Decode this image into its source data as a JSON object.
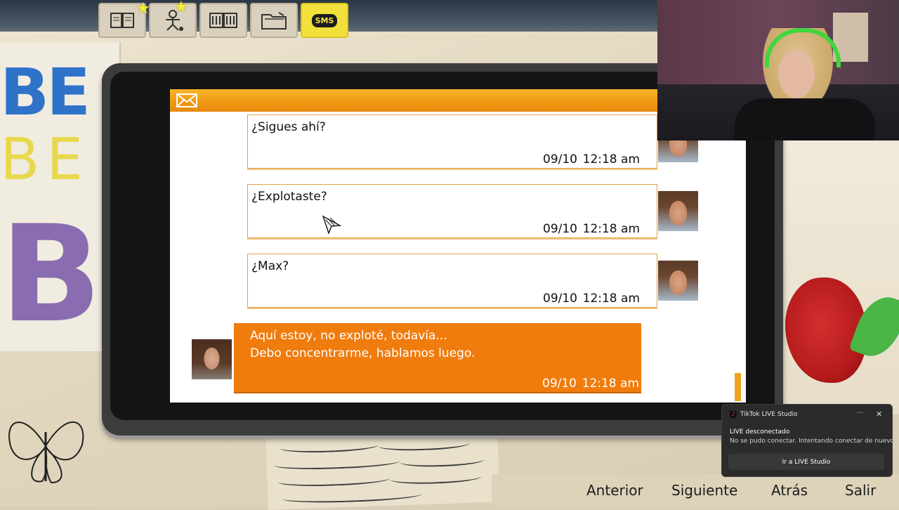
{
  "top_icons": [
    {
      "name": "journal",
      "icon": "journal-icon"
    },
    {
      "name": "character",
      "icon": "character-icon"
    },
    {
      "name": "photos",
      "icon": "photos-icon"
    },
    {
      "name": "folder",
      "icon": "folder-icon"
    },
    {
      "name": "sms",
      "icon": "sms-icon",
      "label": "SMS"
    }
  ],
  "background": {
    "letters": [
      "BE",
      "BE",
      "BI"
    ]
  },
  "messages": [
    {
      "text": "¿Sigues ahí?",
      "date": "09/10",
      "time": "12:18 am"
    },
    {
      "text": "¿Explotaste?",
      "date": "09/10",
      "time": "12:18 am"
    },
    {
      "text": "¿Max?",
      "date": "09/10",
      "time": "12:18 am"
    }
  ],
  "reply": {
    "line1": "Aquí estoy, no exploté, todavía...",
    "line2": "Debo concentrarme, hablamos luego.",
    "date": "09/10",
    "time": "12:18 am"
  },
  "toast": {
    "app": "TikTok LIVE Studio",
    "more": "···",
    "close": "✕",
    "title": "LIVE desconectado",
    "body": "No se pudo conectar. Intentando conectar de nuevo...",
    "button": "Ir a LIVE Studio"
  },
  "nav": {
    "prev": "Anterior",
    "next": "Siguiente",
    "back": "Atrás",
    "exit": "Salir"
  },
  "colors": {
    "header_orange": "#f09a14",
    "reply_orange": "#f07c0e",
    "sms_yellow": "#f2e13a"
  }
}
